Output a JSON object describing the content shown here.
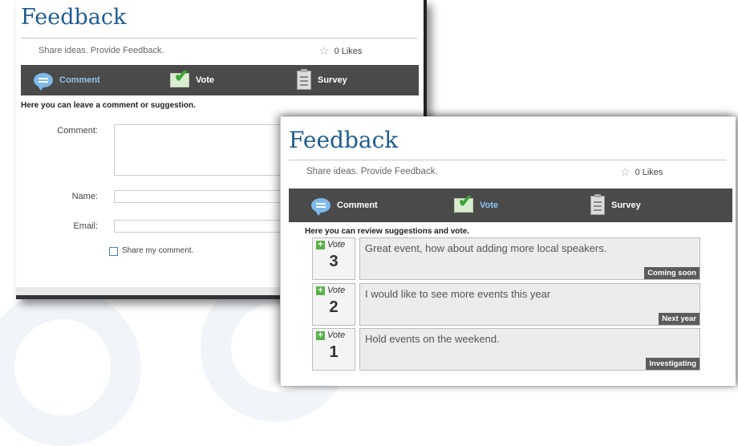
{
  "feedback_title": "Feedback",
  "subtitle": "Share ideas. Provide Feedback.",
  "likes": "0 Likes",
  "tabs": {
    "comment": "Comment",
    "vote": "Vote",
    "survey": "Survey"
  },
  "comment_panel": {
    "instruction": "Here you can leave a comment or suggestion.",
    "comment_label": "Comment:",
    "name_label": "Name:",
    "email_label": "Email:",
    "share_label": "Share my comment."
  },
  "vote_panel": {
    "instruction": "Here you can review suggestions and vote.",
    "vote_word": "Vote",
    "suggestions": [
      {
        "votes": "3",
        "text": "Great event, how about adding more local speakers.",
        "status": "Coming soon"
      },
      {
        "votes": "2",
        "text": "I would like to see more events this year",
        "status": "Next year"
      },
      {
        "votes": "1",
        "text": "Hold events on the weekend.",
        "status": "Investigating"
      }
    ]
  },
  "icons": {
    "comment": "speech-bubble-icon",
    "vote": "checkmark-icon",
    "survey": "clipboard-icon",
    "likes": "star-icon",
    "vote_add": "plus-icon"
  },
  "colors": {
    "title": "#1f5c8f",
    "tabbar": "#4a4a4a",
    "active_tab": "#8fc4ef",
    "vote_plus": "#5ab14a",
    "status_badge": "#5c5c5c"
  }
}
